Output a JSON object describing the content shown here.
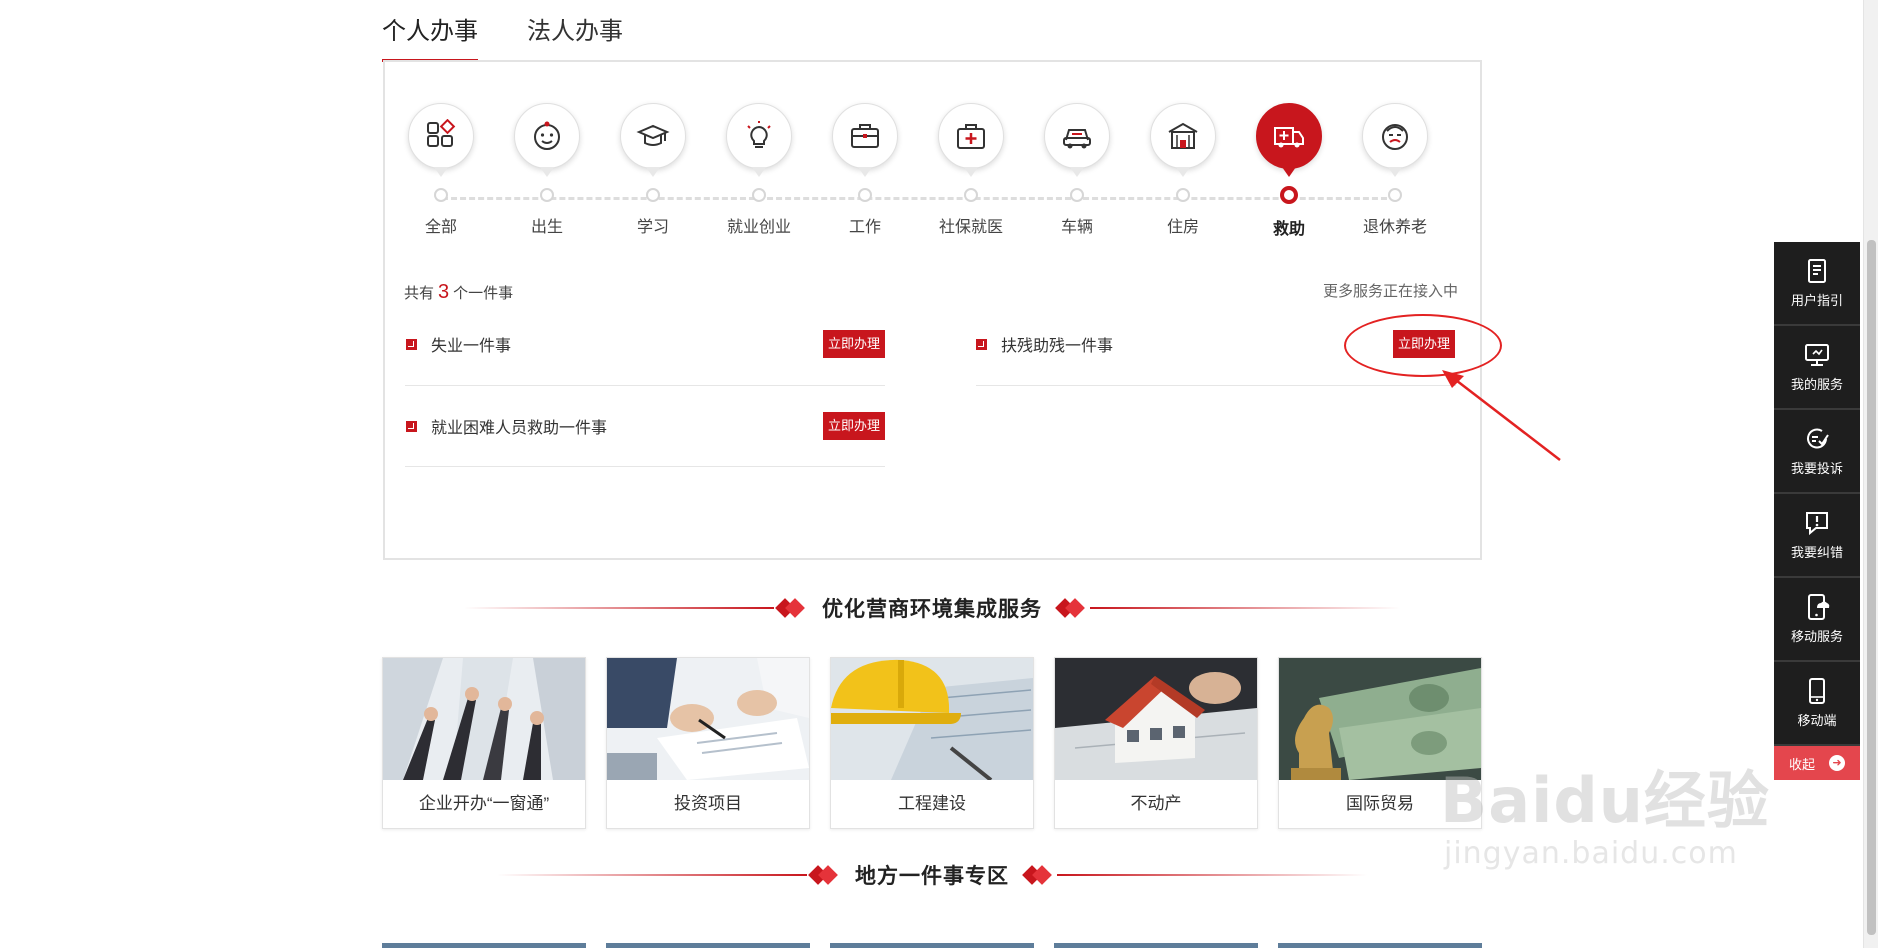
{
  "tabs": [
    {
      "label": "个人办事",
      "active": true
    },
    {
      "label": "法人办事",
      "active": false
    }
  ],
  "categories": [
    {
      "label": "全部",
      "icon": "grid-icon"
    },
    {
      "label": "出生",
      "icon": "baby-face-icon"
    },
    {
      "label": "学习",
      "icon": "graduation-cap-icon"
    },
    {
      "label": "就业创业",
      "icon": "lightbulb-icon"
    },
    {
      "label": "工作",
      "icon": "briefcase-icon"
    },
    {
      "label": "社保就医",
      "icon": "medical-kit-icon"
    },
    {
      "label": "车辆",
      "icon": "car-icon"
    },
    {
      "label": "住房",
      "icon": "house-icon"
    },
    {
      "label": "救助",
      "icon": "ambulance-icon",
      "active": true
    },
    {
      "label": "退休养老",
      "icon": "elder-face-icon"
    }
  ],
  "summary": {
    "prefix": "共有",
    "count": "3",
    "suffix": "个一件事",
    "more_note": "更多服务正在接入中"
  },
  "services": [
    {
      "name": "失业一件事",
      "button": "立即办理"
    },
    {
      "name": "扶残助残一件事",
      "button": "立即办理"
    },
    {
      "name": "就业困难人员救助一件事",
      "button": "立即办理"
    }
  ],
  "sections": {
    "business": "优化营商环境集成服务",
    "local": "地方一件事专区"
  },
  "cards": [
    {
      "caption": "企业开办“一窗通”",
      "image": "raised-fists-photo"
    },
    {
      "caption": "投资项目",
      "image": "signing-documents-photo"
    },
    {
      "caption": "工程建设",
      "image": "hard-hat-blueprint-photo"
    },
    {
      "caption": "不动产",
      "image": "house-model-photo"
    },
    {
      "caption": "国际贸易",
      "image": "banknotes-chess-photo"
    }
  ],
  "sidebar": {
    "items": [
      {
        "label": "用户指引",
        "icon": "guide-book-icon"
      },
      {
        "label": "我的服务",
        "icon": "monitor-icon"
      },
      {
        "label": "我要投诉",
        "icon": "complaint-icon"
      },
      {
        "label": "我要纠错",
        "icon": "error-report-icon"
      },
      {
        "label": "移动服务",
        "icon": "mobile-cloud-icon"
      },
      {
        "label": "移动端",
        "icon": "smartphone-icon"
      }
    ],
    "collapse": "收起"
  },
  "watermark": {
    "brand": "Baidu经验",
    "url": "jingyan.baidu.com"
  },
  "colors": {
    "accent": "#c8161d",
    "annotation": "#e32222",
    "sidebar_bg": "#1e1e1e",
    "collapse_bg": "#e4464d"
  }
}
